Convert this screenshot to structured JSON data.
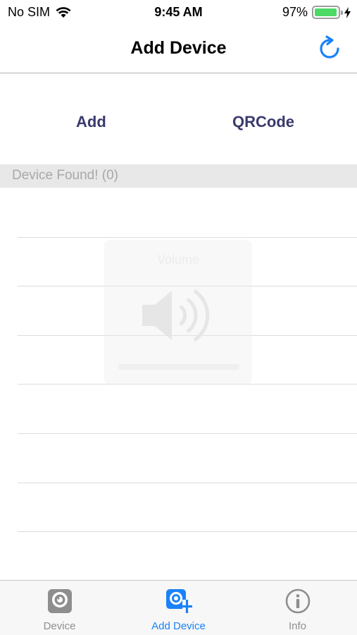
{
  "status_bar": {
    "carrier": "No SIM",
    "time": "9:45 AM",
    "battery_percent": "97%",
    "battery_level": 0.97
  },
  "nav": {
    "title": "Add Device"
  },
  "actions": {
    "add_label": "Add",
    "qrcode_label": "QRCode"
  },
  "section": {
    "header": "Device Found! (0)"
  },
  "overlay": {
    "volume_label": "Volume"
  },
  "tabs": [
    {
      "label": "Device",
      "icon": "camera-icon",
      "active": false
    },
    {
      "label": "Add Device",
      "icon": "add-camera-icon",
      "active": true
    },
    {
      "label": "Info",
      "icon": "info-icon",
      "active": false
    }
  ],
  "colors": {
    "accent": "#1a82f7",
    "action_text": "#3a3a6e",
    "battery": "#4cd964",
    "inactive_tab": "#8e8e8e"
  }
}
